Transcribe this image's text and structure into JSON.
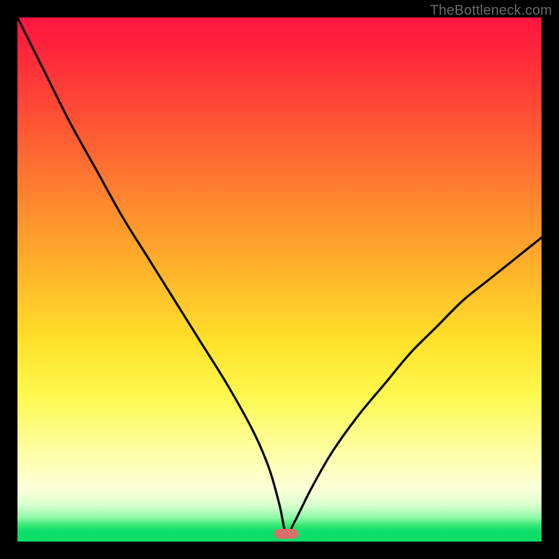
{
  "watermark": "TheBottleneck.com",
  "marker": {
    "x_frac": 0.513,
    "y_frac": 0.985,
    "color": "#d96f6d"
  },
  "chart_data": {
    "type": "line",
    "title": "",
    "xlabel": "",
    "ylabel": "",
    "xlim": [
      0,
      100
    ],
    "ylim": [
      0,
      100
    ],
    "series": [
      {
        "name": "bottleneck-curve",
        "x": [
          0,
          5,
          10,
          15,
          20,
          25,
          30,
          35,
          40,
          45,
          48,
          50,
          51.3,
          53,
          56,
          60,
          65,
          70,
          75,
          80,
          85,
          90,
          95,
          100
        ],
        "y": [
          100,
          90,
          80,
          71,
          62,
          54,
          46,
          38,
          30,
          21,
          14,
          7,
          1.5,
          4,
          10,
          17,
          24,
          30,
          36,
          41,
          46,
          50,
          54,
          58
        ]
      }
    ],
    "annotations": [
      {
        "type": "marker",
        "shape": "pill",
        "x": 51.3,
        "y": 1.5,
        "color": "#d96f6d"
      }
    ],
    "background_gradient": {
      "direction": "vertical",
      "stops": [
        {
          "pos": 0.0,
          "color": "#ff1440"
        },
        {
          "pos": 0.5,
          "color": "#ffb92a"
        },
        {
          "pos": 0.72,
          "color": "#fdf84d"
        },
        {
          "pos": 0.9,
          "color": "#fbffd8"
        },
        {
          "pos": 1.0,
          "color": "#07dd67"
        }
      ]
    }
  }
}
